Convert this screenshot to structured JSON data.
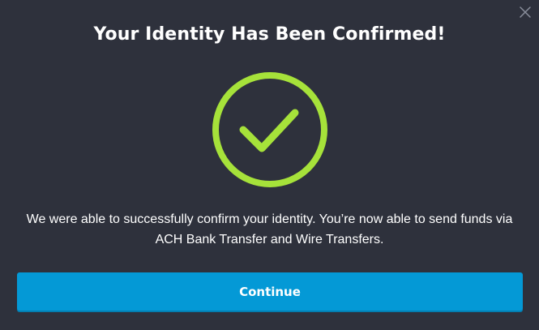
{
  "modal": {
    "title": "Your Identity Has Been Confirmed!",
    "message": "We were able to successfully confirm your identity. You’re now able to send funds via ACH Bank Transfer and Wire Transfers.",
    "continue_label": "Continue",
    "close_icon": "close-icon",
    "status_icon": "check-circle-icon"
  },
  "colors": {
    "background": "#2e313c",
    "accent_check": "#a6e23a",
    "button": "#0499d6",
    "text": "#ffffff"
  }
}
